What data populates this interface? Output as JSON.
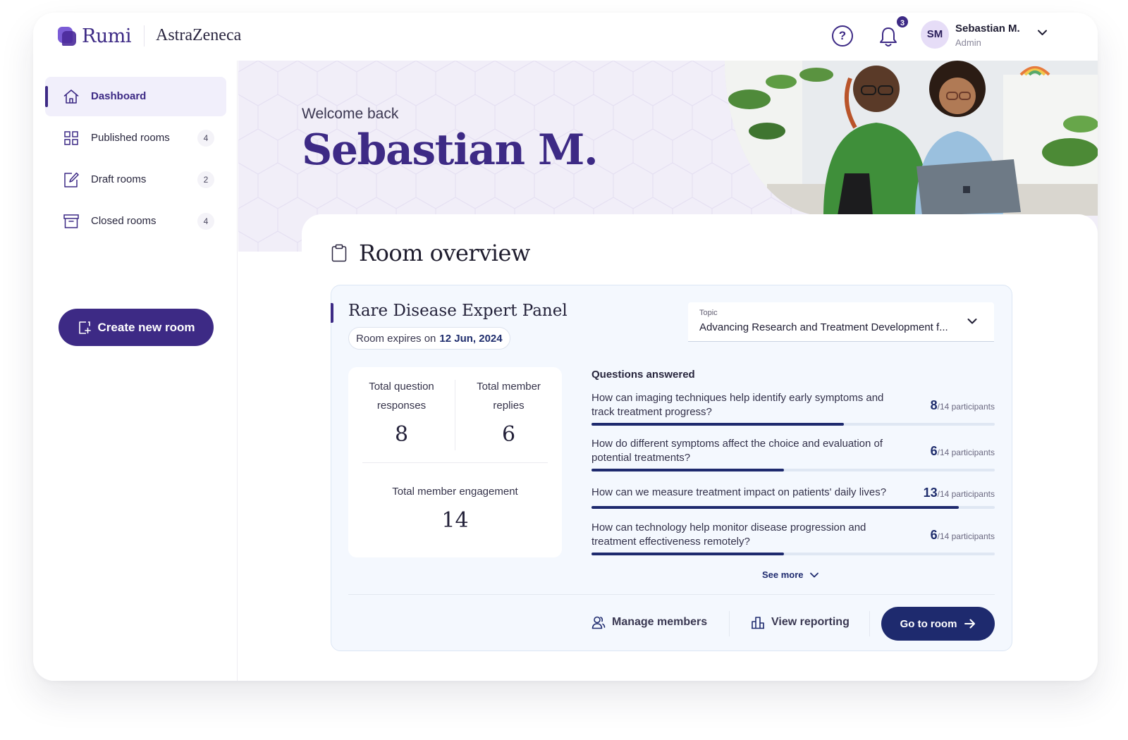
{
  "brand": {
    "logo_text": "Rumi",
    "partner": "AstraZeneca"
  },
  "header": {
    "notifications_count": "3",
    "user_initials": "SM",
    "user_name": "Sebastian M.",
    "user_role": "Admin"
  },
  "sidebar": {
    "items": [
      {
        "label": "Dashboard",
        "icon": "home-icon",
        "active": true
      },
      {
        "label": "Published rooms",
        "icon": "grid-icon",
        "count": "4"
      },
      {
        "label": "Draft rooms",
        "icon": "edit-icon",
        "count": "2"
      },
      {
        "label": "Closed rooms",
        "icon": "archive-icon",
        "count": "4"
      }
    ],
    "create_label": "Create new room"
  },
  "hero": {
    "welcome": "Welcome back",
    "name": "Sebastian M."
  },
  "overview": {
    "title": "Room overview",
    "room": {
      "title": "Rare Disease Expert Panel",
      "expires_prefix": "Room expires on",
      "expires_date": "12 Jun, 2024",
      "topic_label": "Topic",
      "topic_value": "Advancing Research and Treatment Development f..."
    },
    "stats": {
      "question_responses_label_1": "Total question",
      "question_responses_label_2": "responses",
      "question_responses_value": "8",
      "member_replies_label_1": "Total member",
      "member_replies_label_2": "replies",
      "member_replies_value": "6",
      "engagement_label": "Total member engagement",
      "engagement_value": "14"
    },
    "questions_title": "Questions answered",
    "questions": [
      {
        "text": "How can imaging techniques help identify early symptoms and track treatment progress?",
        "answered": "8",
        "total_suffix": "/14 participants",
        "fraction": 0.6254
      },
      {
        "text": "How do different symptoms affect the choice and evaluation of potential treatments?",
        "answered": "6",
        "total_suffix": "/14 participants",
        "fraction": 0.4769
      },
      {
        "text": "How can we measure treatment impact on patients' daily lives?",
        "answered": "13",
        "total_suffix": "/14 participants",
        "fraction": 0.9108
      },
      {
        "text": "How can technology help monitor disease progression and treatment effectiveness remotely?",
        "answered": "6",
        "total_suffix": "/14 participants",
        "fraction": 0.4769
      }
    ],
    "see_more": "See more",
    "actions": {
      "manage_members": "Manage members",
      "view_reporting": "View reporting",
      "go_to_room": "Go to room"
    }
  },
  "colors": {
    "brand_purple": "#3d2a85",
    "navy": "#1e2a6e",
    "hero_bg": "#f1eef8",
    "card_bg": "#f4f8fe"
  }
}
